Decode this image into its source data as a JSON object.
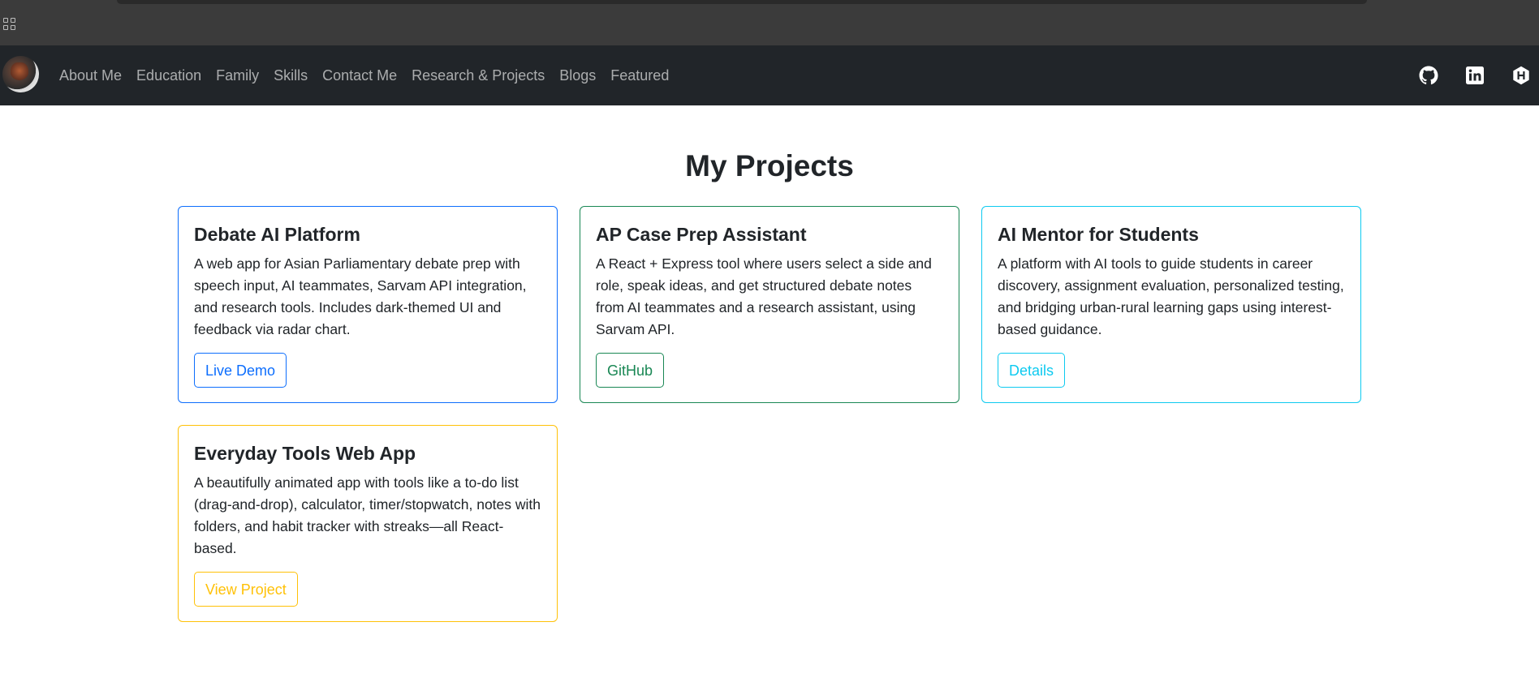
{
  "nav": {
    "avatar_alt": "profile-avatar",
    "links": [
      "About Me",
      "Education",
      "Family",
      "Skills",
      "Contact Me",
      "Research & Projects",
      "Blogs",
      "Featured"
    ],
    "icons": [
      "github-icon",
      "linkedin-icon",
      "hashnode-icon"
    ]
  },
  "page": {
    "title": "My Projects"
  },
  "projects": [
    {
      "title": "Debate AI Platform",
      "description": "A web app for Asian Parliamentary debate prep with speech input, AI teammates, Sarvam API integration, and research tools. Includes dark-themed UI and feedback via radar chart.",
      "button": "Live Demo",
      "color": "#0d6efd"
    },
    {
      "title": "AP Case Prep Assistant",
      "description": "A React + Express tool where users select a side and role, speak ideas, and get structured debate notes from AI teammates and a research assistant, using Sarvam API.",
      "button": "GitHub",
      "color": "#198754"
    },
    {
      "title": "AI Mentor for Students",
      "description": "A platform with AI tools to guide students in career discovery, assignment evaluation, personalized testing, and bridging urban-rural learning gaps using interest-based guidance.",
      "button": "Details",
      "color": "#0dcaf0"
    },
    {
      "title": "Everyday Tools Web App",
      "description": "A beautifully animated app with tools like a to-do list (drag-and-drop), calculator, timer/stopwatch, notes with folders, and habit tracker with streaks—all React-based.",
      "button": "View Project",
      "color": "#ffc107"
    }
  ]
}
